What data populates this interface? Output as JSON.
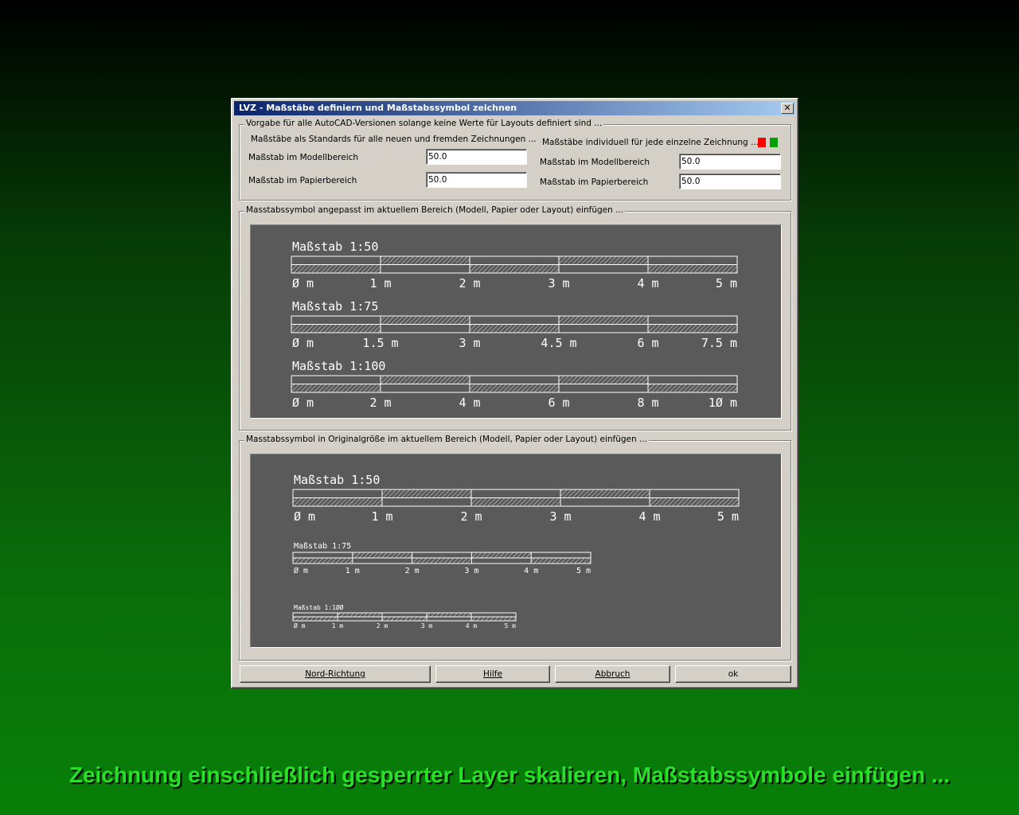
{
  "dialog": {
    "title": "LVZ - Maßstäbe definiern und Maßstabssymbol zeichnen",
    "close_glyph": "✕"
  },
  "defaults_group": {
    "legend": "Vorgabe für alle AutoCAD-Versionen solange keine Werte für Layouts definiert sind ...",
    "standards_heading": "Maßstäbe als Standards für alle neuen und fremden Zeichnungen ...",
    "model_label": "Maßstab im Modellbereich",
    "model_value": "50.0",
    "paper_label": "Maßstab im Papierbereich",
    "paper_value": "50.0",
    "individual_heading": "Maßstäbe individuell für jede einzelne Zeichnung ...",
    "ind_model_label": "Maßstab im Modellbereich",
    "ind_model_value": "50.0",
    "ind_paper_label": "Maßstab im Papierbereich",
    "ind_paper_value": "50.0",
    "flag_colors": [
      "#ff0000",
      "#00a000"
    ]
  },
  "adapted_group": {
    "legend": "Masstabssymbol angepasst im aktuellem Bereich (Modell, Papier oder Layout) einfügen ...",
    "bars": [
      {
        "title": "Maßstab 1:50",
        "ticks": [
          "Ø m",
          "1 m",
          "2 m",
          "3 m",
          "4 m",
          "5 m"
        ]
      },
      {
        "title": "Maßstab 1:75",
        "ticks": [
          "Ø m",
          "1.5 m",
          "3 m",
          "4.5 m",
          "6 m",
          "7.5 m"
        ]
      },
      {
        "title": "Maßstab 1:100",
        "ticks": [
          "Ø m",
          "2 m",
          "4 m",
          "6 m",
          "8 m",
          "1Ø m"
        ]
      }
    ]
  },
  "original_group": {
    "legend": "Masstabssymbol in Originalgröße im aktuellem Bereich (Modell, Papier oder Layout) einfügen ...",
    "bars": [
      {
        "title": "Maßstab 1:50",
        "ticks": [
          "Ø m",
          "1 m",
          "2 m",
          "3 m",
          "4 m",
          "5 m"
        ]
      },
      {
        "title": "Maßstab 1:75",
        "ticks": [
          "Ø m",
          "1 m",
          "2 m",
          "3 m",
          "4 m",
          "5 m"
        ]
      },
      {
        "title": "Maßstab 1:1ØØ",
        "ticks": [
          "Ø m",
          "1 m",
          "2 m",
          "3 m",
          "4 m",
          "5 m"
        ]
      }
    ]
  },
  "buttons": {
    "north": "Nord-Richtung",
    "help": "Hilfe",
    "cancel": "Abbruch",
    "ok": "ok"
  },
  "caption": "Zeichnung einschließlich gesperrter Layer skalieren, Maßstabssymbole einfügen ..."
}
